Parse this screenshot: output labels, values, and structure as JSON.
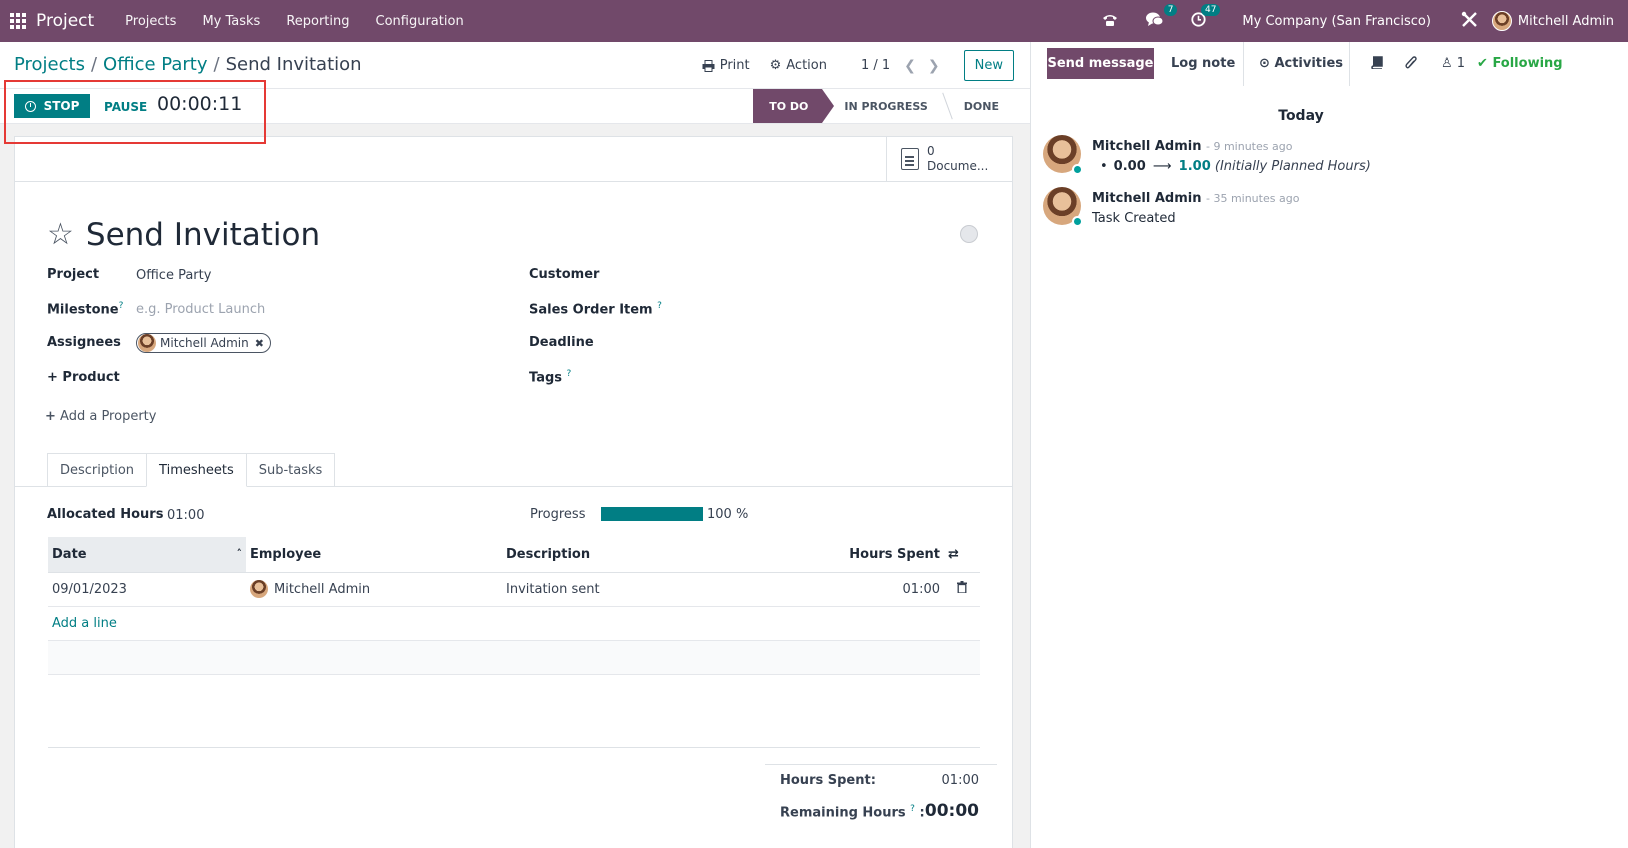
{
  "topbar": {
    "app_name": "Project",
    "menu": [
      "Projects",
      "My Tasks",
      "Reporting",
      "Configuration"
    ],
    "messages_count": "7",
    "activities_count": "47",
    "company": "My Company (San Francisco)",
    "user": "Mitchell Admin"
  },
  "breadcrumb": {
    "root": "Projects",
    "project": "Office Party",
    "current": "Send Invitation"
  },
  "control_panel": {
    "print": "Print",
    "action": "Action",
    "pager": "1 / 1",
    "new": "New"
  },
  "timer": {
    "stop": "STOP",
    "pause": "PAUSE",
    "elapsed": "00:00:11"
  },
  "stages": [
    "TO DO",
    "IN PROGRESS",
    "DONE"
  ],
  "active_stage": "TO DO",
  "smart_button": {
    "count": "0",
    "label": "Docume..."
  },
  "task": {
    "title": "Send Invitation",
    "fields": {
      "project_label": "Project",
      "project_value": "Office Party",
      "milestone_label": "Milestone",
      "milestone_placeholder": "e.g. Product Launch",
      "assignees_label": "Assignees",
      "assignee": "Mitchell Admin",
      "product_label": "+ Product",
      "customer_label": "Customer",
      "sale_line_label": "Sales Order Item",
      "deadline_label": "Deadline",
      "tags_label": "Tags",
      "help_mark": "?"
    },
    "add_property": "Add a Property"
  },
  "tabs": [
    "Description",
    "Timesheets",
    "Sub-tasks"
  ],
  "active_tab": "Timesheets",
  "timesheets": {
    "allocated_label": "Allocated Hours",
    "allocated_value": "01:00",
    "progress_label": "Progress",
    "progress_value": "100 %",
    "progress_fraction": 1.0,
    "columns": [
      "Date",
      "Employee",
      "Description",
      "Hours Spent"
    ],
    "rows": [
      {
        "date": "09/01/2023",
        "employee": "Mitchell Admin",
        "description": "Invitation sent",
        "hours": "01:00"
      }
    ],
    "add_line": "Add a line",
    "hours_spent_label": "Hours Spent:",
    "hours_spent_value": "01:00",
    "remaining_label": "Remaining Hours",
    "remaining_value": "00:00"
  },
  "chatter": {
    "send_message": "Send message",
    "log_note": "Log note",
    "activities": "Activities",
    "followers_count": "1",
    "following": "Following",
    "day": "Today",
    "messages": [
      {
        "author": "Mitchell Admin",
        "ago": "- 9 minutes ago",
        "old": "0.00",
        "new": "1.00",
        "field": "(Initially Planned Hours)"
      },
      {
        "author": "Mitchell Admin",
        "ago": "- 35 minutes ago",
        "text": "Task Created"
      }
    ]
  },
  "colors": {
    "brand": "#71496a",
    "accent": "#017e84",
    "highlight": "#e53935",
    "following": "#28a745"
  }
}
